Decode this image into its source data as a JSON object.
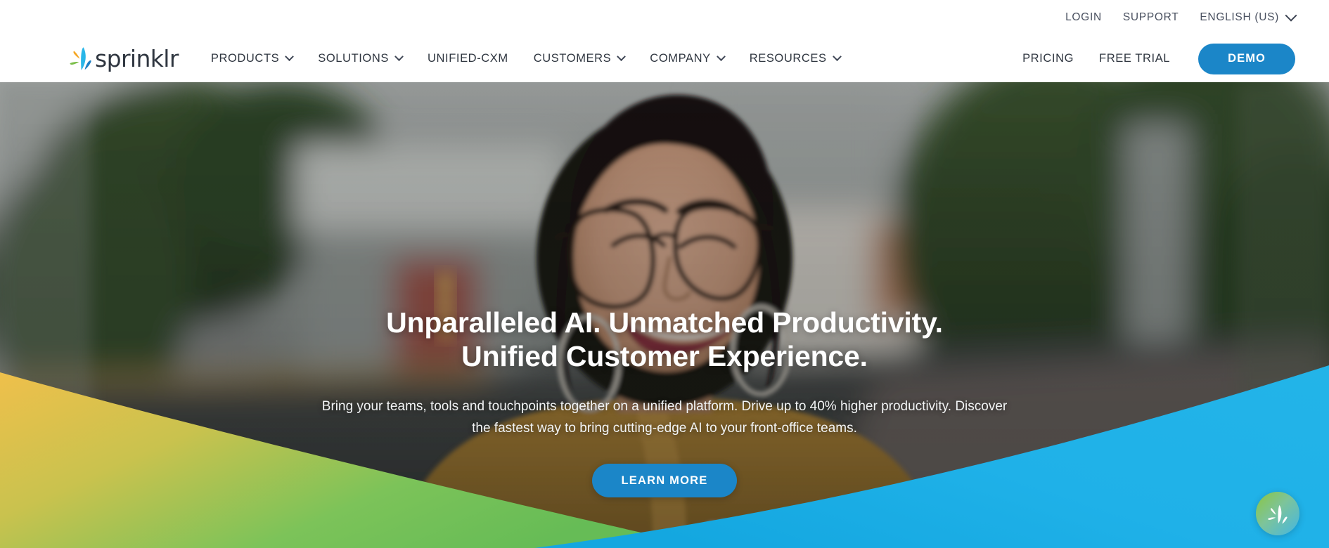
{
  "header": {
    "brand": {
      "name": "sprinklr",
      "logo_icon": "sprinklr-splash-logo",
      "colors": {
        "orange": "#F5A623",
        "green": "#7CBF4B",
        "cyan": "#29B6E8",
        "blue": "#1E7FC4"
      }
    },
    "utility_links": [
      {
        "label": "LOGIN",
        "name": "login"
      },
      {
        "label": "SUPPORT",
        "name": "support"
      }
    ],
    "language": {
      "label": "ENGLISH (US)",
      "icon": "chevron-down-icon"
    },
    "nav_items": [
      {
        "label": "PRODUCTS",
        "name": "products",
        "has_dropdown": true
      },
      {
        "label": "SOLUTIONS",
        "name": "solutions",
        "has_dropdown": true
      },
      {
        "label": "UNIFIED-CXM",
        "name": "unified-cxm",
        "has_dropdown": false
      },
      {
        "label": "CUSTOMERS",
        "name": "customers",
        "has_dropdown": true
      },
      {
        "label": "COMPANY",
        "name": "company",
        "has_dropdown": true
      },
      {
        "label": "RESOURCES",
        "name": "resources",
        "has_dropdown": true
      }
    ],
    "right_links": [
      {
        "label": "PRICING",
        "name": "pricing"
      },
      {
        "label": "FREE TRIAL",
        "name": "free-trial"
      }
    ],
    "demo_button": {
      "label": "DEMO",
      "color": "#1B86C8"
    }
  },
  "hero": {
    "title_line1": "Unparalleled AI. Unmatched Productivity.",
    "title_line2": "Unified Customer Experience.",
    "subtitle": "Bring your teams, tools and touchpoints together on a unified platform. Drive up to 40% higher productivity. Discover the fastest way to bring cutting-edge AI to your front-office teams.",
    "cta": {
      "label": "LEARN MORE",
      "color": "#1B86C8"
    },
    "background_image": "smiling-woman-with-glasses-on-city-street",
    "decor": {
      "left_wave_colors": [
        "#EFC04B",
        "#6FBE5A"
      ],
      "right_wave_colors": [
        "#2BB8E8",
        "#14A7E0"
      ]
    }
  },
  "chat_widget": {
    "name": "sprinklr-chat-launcher",
    "icon": "sprinklr-splash-logo",
    "gradient": [
      "#8CC63F",
      "#43B6E3"
    ]
  }
}
